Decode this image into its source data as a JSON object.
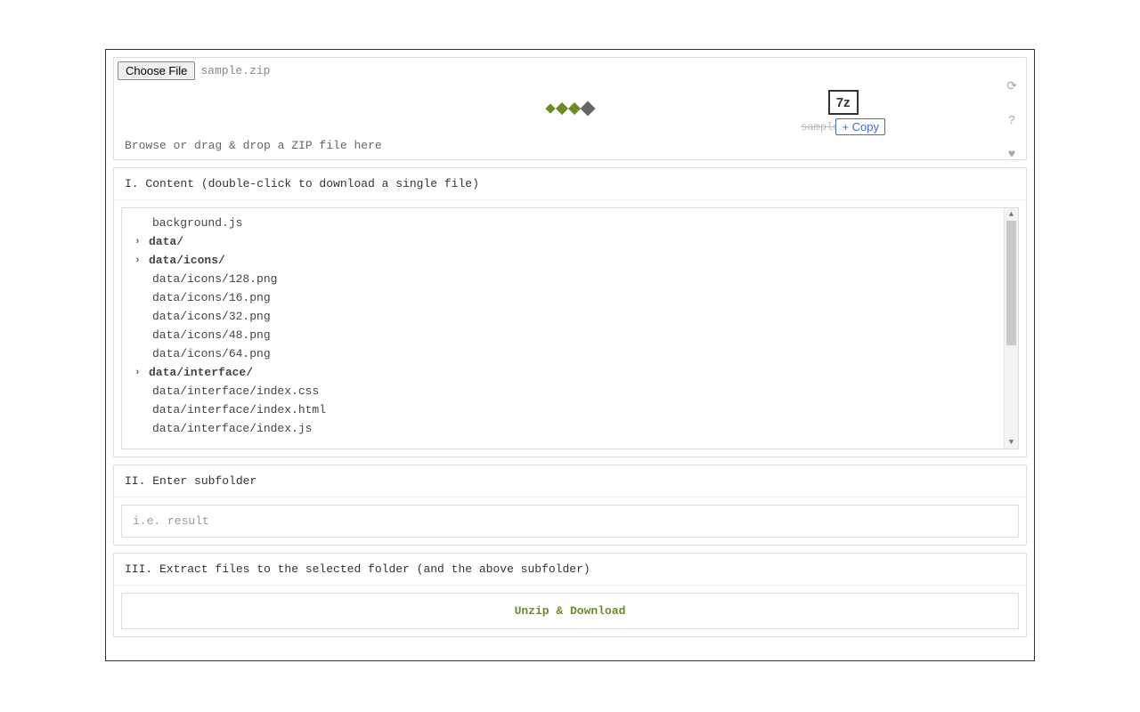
{
  "file_picker": {
    "button_label": "Choose File",
    "selected_file": "sample.zip",
    "drop_hint": "Browse or drag & drop a ZIP file here"
  },
  "callout": {
    "format_label": "7z",
    "sample_label": "sample",
    "copy_label": "+ Copy"
  },
  "side_icons": {
    "reload": "⟳",
    "help": "?",
    "heart": "♥"
  },
  "section_content": {
    "header": "I. Content (double-click to download a single file)",
    "tree": [
      {
        "type": "file",
        "label": "background.js"
      },
      {
        "type": "folder",
        "label": "data/"
      },
      {
        "type": "folder",
        "label": "data/icons/"
      },
      {
        "type": "file",
        "label": "data/icons/128.png"
      },
      {
        "type": "file",
        "label": "data/icons/16.png"
      },
      {
        "type": "file",
        "label": "data/icons/32.png"
      },
      {
        "type": "file",
        "label": "data/icons/48.png"
      },
      {
        "type": "file",
        "label": "data/icons/64.png"
      },
      {
        "type": "folder",
        "label": "data/interface/"
      },
      {
        "type": "file",
        "label": "data/interface/index.css"
      },
      {
        "type": "file",
        "label": "data/interface/index.html"
      },
      {
        "type": "file",
        "label": "data/interface/index.js"
      }
    ]
  },
  "section_subfolder": {
    "header": "II. Enter subfolder",
    "placeholder": "i.e. result"
  },
  "section_extract": {
    "header": "III. Extract files to the selected folder (and the above subfolder)",
    "button_label": "Unzip & Download"
  }
}
